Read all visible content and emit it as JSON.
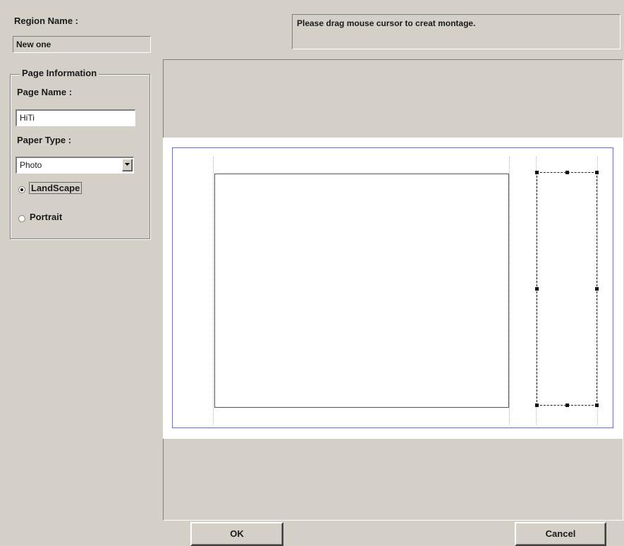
{
  "region": {
    "label": "Region Name :",
    "value": "New one"
  },
  "status": {
    "message": "Please drag mouse cursor to creat montage."
  },
  "page_info": {
    "legend": "Page Information",
    "page_name_label": "Page Name :",
    "page_name_value": "HiTi",
    "paper_type_label": "Paper Type :",
    "paper_type_selected": "Photo",
    "orientation": {
      "options": [
        "LandScape",
        "Portrait"
      ],
      "selected": "LandScape"
    }
  },
  "buttons": {
    "ok": "OK",
    "cancel": "Cancel"
  },
  "colors": {
    "page_border": "#6b6bd6",
    "window_bg": "#d4d0c8"
  },
  "icons": {
    "dropdown": "chevron-down-icon"
  }
}
